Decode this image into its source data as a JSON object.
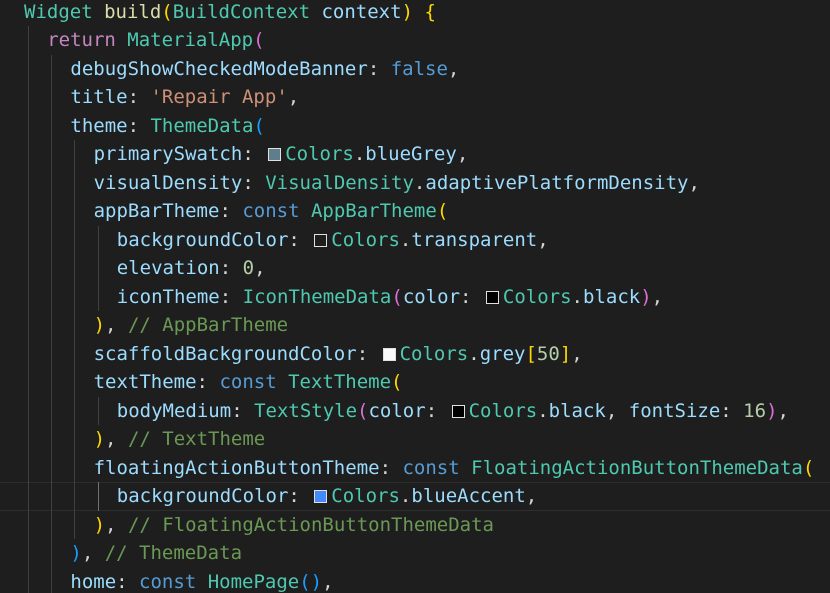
{
  "colors": {
    "keyword": "#569cd6",
    "control": "#c586c0",
    "class": "#4ec9b0",
    "func": "#dcdcaa",
    "prop": "#9cdcfe",
    "string": "#ce9178",
    "number": "#b5cea8",
    "comment": "#6a9955",
    "plain": "#d4d4d4",
    "bracket_gold": "#ffd700",
    "bracket_magenta": "#da70d6",
    "bracket_blue": "#179fff",
    "swatch_bluegrey": "#607d8b",
    "swatch_transparent": "#1e1e1e",
    "swatch_black": "#000000",
    "swatch_grey50": "#fafafa",
    "swatch_blueaccent": "#448aff"
  },
  "code_lines": [
    {
      "indent": 0,
      "tokens": [
        {
          "t": "Widget",
          "c": "class"
        },
        {
          "t": " "
        },
        {
          "t": "build",
          "c": "func"
        },
        {
          "t": "(",
          "c": "bracket_gold"
        },
        {
          "t": "BuildContext",
          "c": "class"
        },
        {
          "t": " "
        },
        {
          "t": "context",
          "c": "prop"
        },
        {
          "t": ")",
          "c": "bracket_gold"
        },
        {
          "t": " "
        },
        {
          "t": "{",
          "c": "bracket_gold"
        }
      ]
    },
    {
      "indent": 1,
      "tokens": [
        {
          "t": "return",
          "c": "control"
        },
        {
          "t": " "
        },
        {
          "t": "MaterialApp",
          "c": "class"
        },
        {
          "t": "(",
          "c": "bracket_magenta"
        }
      ]
    },
    {
      "indent": 2,
      "tokens": [
        {
          "t": "debugShowCheckedModeBanner",
          "c": "prop"
        },
        {
          "t": ": "
        },
        {
          "t": "false",
          "c": "keyword"
        },
        {
          "t": ","
        }
      ]
    },
    {
      "indent": 2,
      "tokens": [
        {
          "t": "title",
          "c": "prop"
        },
        {
          "t": ": "
        },
        {
          "t": "'Repair App'",
          "c": "string"
        },
        {
          "t": ","
        }
      ]
    },
    {
      "indent": 2,
      "tokens": [
        {
          "t": "theme",
          "c": "prop"
        },
        {
          "t": ": "
        },
        {
          "t": "ThemeData",
          "c": "class"
        },
        {
          "t": "(",
          "c": "bracket_blue"
        }
      ]
    },
    {
      "indent": 3,
      "tokens": [
        {
          "t": "primarySwatch",
          "c": "prop"
        },
        {
          "t": ": "
        },
        {
          "swatch": "swatch_bluegrey"
        },
        {
          "t": "Colors",
          "c": "class"
        },
        {
          "t": "."
        },
        {
          "t": "blueGrey",
          "c": "prop"
        },
        {
          "t": ","
        }
      ]
    },
    {
      "indent": 3,
      "tokens": [
        {
          "t": "visualDensity",
          "c": "prop"
        },
        {
          "t": ": "
        },
        {
          "t": "VisualDensity",
          "c": "class"
        },
        {
          "t": "."
        },
        {
          "t": "adaptivePlatformDensity",
          "c": "prop"
        },
        {
          "t": ","
        }
      ]
    },
    {
      "indent": 3,
      "tokens": [
        {
          "t": "appBarTheme",
          "c": "prop"
        },
        {
          "t": ": "
        },
        {
          "t": "const",
          "c": "keyword"
        },
        {
          "t": " "
        },
        {
          "t": "AppBarTheme",
          "c": "class"
        },
        {
          "t": "(",
          "c": "bracket_gold"
        }
      ]
    },
    {
      "indent": 4,
      "tokens": [
        {
          "t": "backgroundColor",
          "c": "prop"
        },
        {
          "t": ": "
        },
        {
          "swatch": "swatch_transparent"
        },
        {
          "t": "Colors",
          "c": "class"
        },
        {
          "t": "."
        },
        {
          "t": "transparent",
          "c": "prop"
        },
        {
          "t": ","
        }
      ]
    },
    {
      "indent": 4,
      "tokens": [
        {
          "t": "elevation",
          "c": "prop"
        },
        {
          "t": ": "
        },
        {
          "t": "0",
          "c": "number"
        },
        {
          "t": ","
        }
      ]
    },
    {
      "indent": 4,
      "tokens": [
        {
          "t": "iconTheme",
          "c": "prop"
        },
        {
          "t": ": "
        },
        {
          "t": "IconThemeData",
          "c": "class"
        },
        {
          "t": "(",
          "c": "bracket_magenta"
        },
        {
          "t": "color",
          "c": "prop"
        },
        {
          "t": ": "
        },
        {
          "swatch": "swatch_black"
        },
        {
          "t": "Colors",
          "c": "class"
        },
        {
          "t": "."
        },
        {
          "t": "black",
          "c": "prop"
        },
        {
          "t": ")",
          "c": "bracket_magenta"
        },
        {
          "t": ","
        }
      ]
    },
    {
      "indent": 3,
      "tokens": [
        {
          "t": ")",
          "c": "bracket_gold"
        },
        {
          "t": ", "
        },
        {
          "t": "// AppBarTheme",
          "c": "comment"
        }
      ]
    },
    {
      "indent": 3,
      "tokens": [
        {
          "t": "scaffoldBackgroundColor",
          "c": "prop"
        },
        {
          "t": ": "
        },
        {
          "swatch": "swatch_grey50"
        },
        {
          "t": "Colors",
          "c": "class"
        },
        {
          "t": "."
        },
        {
          "t": "grey",
          "c": "prop"
        },
        {
          "t": "[",
          "c": "bracket_gold"
        },
        {
          "t": "50",
          "c": "number"
        },
        {
          "t": "]",
          "c": "bracket_gold"
        },
        {
          "t": ","
        }
      ]
    },
    {
      "indent": 3,
      "tokens": [
        {
          "t": "textTheme",
          "c": "prop"
        },
        {
          "t": ": "
        },
        {
          "t": "const",
          "c": "keyword"
        },
        {
          "t": " "
        },
        {
          "t": "TextTheme",
          "c": "class"
        },
        {
          "t": "(",
          "c": "bracket_gold"
        }
      ]
    },
    {
      "indent": 4,
      "tokens": [
        {
          "t": "bodyMedium",
          "c": "prop"
        },
        {
          "t": ": "
        },
        {
          "t": "TextStyle",
          "c": "class"
        },
        {
          "t": "(",
          "c": "bracket_magenta"
        },
        {
          "t": "color",
          "c": "prop"
        },
        {
          "t": ": "
        },
        {
          "swatch": "swatch_black"
        },
        {
          "t": "Colors",
          "c": "class"
        },
        {
          "t": "."
        },
        {
          "t": "black",
          "c": "prop"
        },
        {
          "t": ", "
        },
        {
          "t": "fontSize",
          "c": "prop"
        },
        {
          "t": ": "
        },
        {
          "t": "16",
          "c": "number"
        },
        {
          "t": ")",
          "c": "bracket_magenta"
        },
        {
          "t": ","
        }
      ]
    },
    {
      "indent": 3,
      "tokens": [
        {
          "t": ")",
          "c": "bracket_gold"
        },
        {
          "t": ", "
        },
        {
          "t": "// TextTheme",
          "c": "comment"
        }
      ]
    },
    {
      "indent": 3,
      "tokens": [
        {
          "t": "floatingActionButtonTheme",
          "c": "prop"
        },
        {
          "t": ": "
        },
        {
          "t": "const",
          "c": "keyword"
        },
        {
          "t": " "
        },
        {
          "t": "FloatingActionButtonThemeData",
          "c": "class"
        },
        {
          "t": "(",
          "c": "bracket_gold"
        }
      ]
    },
    {
      "indent": 4,
      "current": true,
      "tokens": [
        {
          "t": "backgroundColor",
          "c": "prop"
        },
        {
          "t": ": "
        },
        {
          "swatch": "swatch_blueaccent"
        },
        {
          "t": "Colors",
          "c": "class"
        },
        {
          "t": "."
        },
        {
          "t": "blueAccent",
          "c": "prop"
        },
        {
          "t": ","
        }
      ]
    },
    {
      "indent": 3,
      "tokens": [
        {
          "t": ")",
          "c": "bracket_gold"
        },
        {
          "t": ", "
        },
        {
          "t": "// FloatingActionButtonThemeData",
          "c": "comment"
        }
      ]
    },
    {
      "indent": 2,
      "tokens": [
        {
          "t": ")",
          "c": "bracket_blue"
        },
        {
          "t": ", "
        },
        {
          "t": "// ThemeData",
          "c": "comment"
        }
      ]
    },
    {
      "indent": 2,
      "tokens": [
        {
          "t": "home",
          "c": "prop"
        },
        {
          "t": ": "
        },
        {
          "t": "const",
          "c": "keyword"
        },
        {
          "t": " "
        },
        {
          "t": "HomePage",
          "c": "class"
        },
        {
          "t": "(",
          "c": "bracket_blue"
        },
        {
          "t": ")",
          "c": "bracket_blue"
        },
        {
          "t": ","
        }
      ]
    }
  ]
}
